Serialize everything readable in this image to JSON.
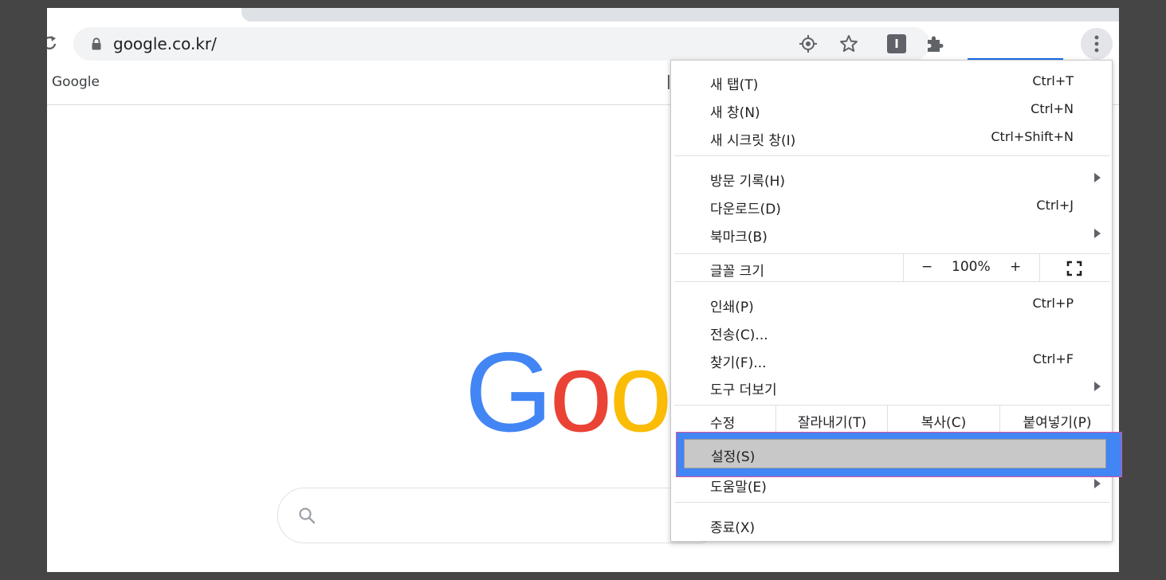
{
  "browser": {
    "url": "google.co.kr/",
    "bookmark": "Google"
  },
  "page": {
    "logo_letters": [
      "G",
      "o",
      "o"
    ],
    "logo_colors": [
      "#4285f4",
      "#ea4335",
      "#fbbc05"
    ]
  },
  "menu": {
    "new_tab": {
      "label": "새 탭(T)",
      "shortcut": "Ctrl+T"
    },
    "new_window": {
      "label": "새 창(N)",
      "shortcut": "Ctrl+N"
    },
    "incognito": {
      "label": "새 시크릿 창(I)",
      "shortcut": "Ctrl+Shift+N"
    },
    "history": {
      "label": "방문 기록(H)"
    },
    "downloads": {
      "label": "다운로드(D)",
      "shortcut": "Ctrl+J"
    },
    "bookmarks": {
      "label": "북마크(B)"
    },
    "zoom": {
      "label": "글꼴 크기",
      "minus": "−",
      "value": "100%",
      "plus": "+"
    },
    "print": {
      "label": "인쇄(P)",
      "shortcut": "Ctrl+P"
    },
    "cast": {
      "label": "전송(C)..."
    },
    "find": {
      "label": "찾기(F)...",
      "shortcut": "Ctrl+F"
    },
    "more_tools": {
      "label": "도구 더보기"
    },
    "edit": {
      "label": "수정",
      "cut": "잘라내기(T)",
      "copy": "복사(C)",
      "paste": "붙여넣기(P)"
    },
    "settings": {
      "label": "설정(S)"
    },
    "help": {
      "label": "도움말(E)"
    },
    "exit": {
      "label": "종료(X)"
    }
  },
  "colors": {
    "highlight": "#4285f4",
    "selection": "#c8c8c8"
  }
}
